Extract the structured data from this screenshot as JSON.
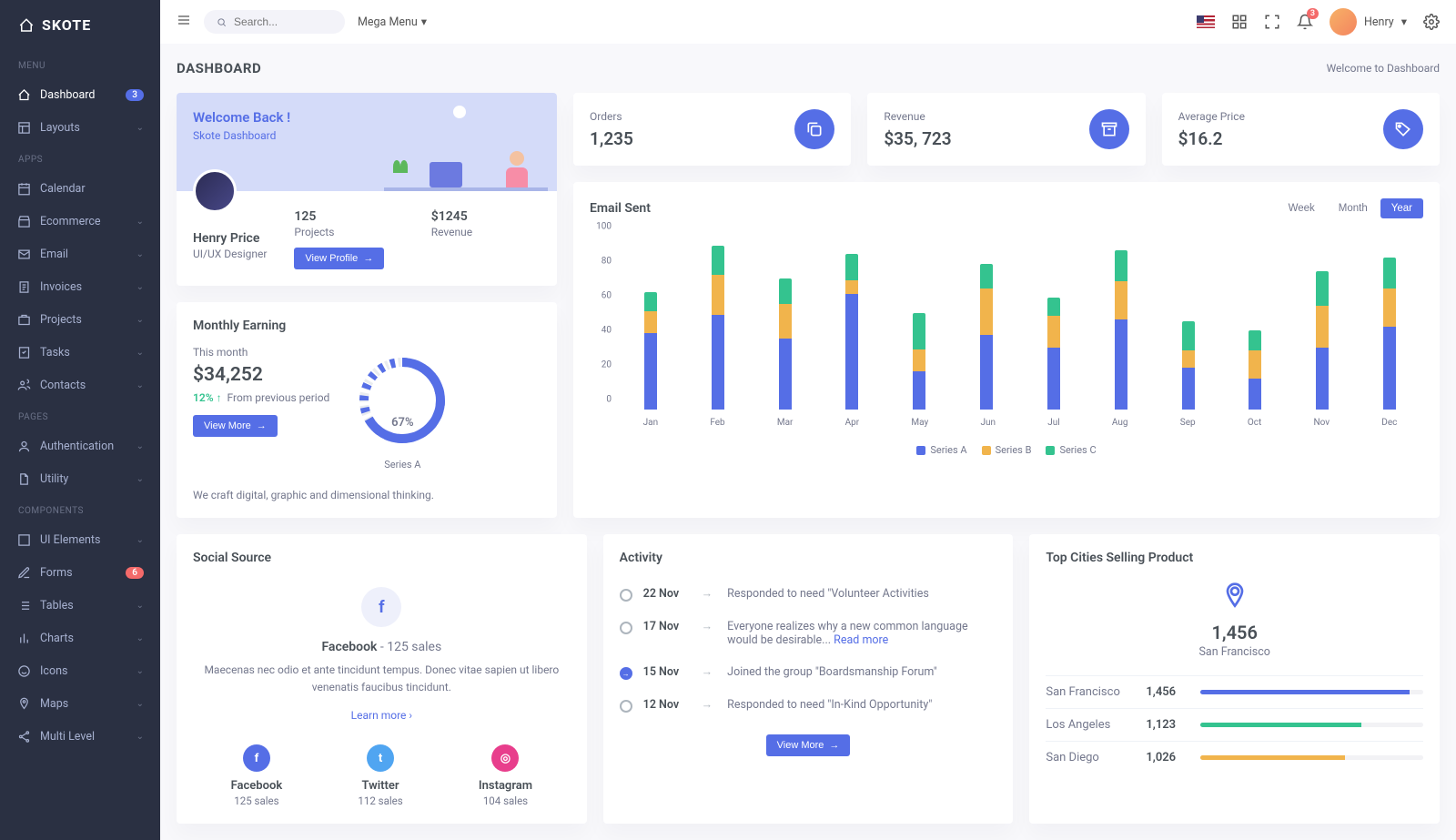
{
  "brand": "SKOTE",
  "header": {
    "search_placeholder": "Search...",
    "mega_menu": "Mega Menu",
    "username": "Henry",
    "notif_count": "3"
  },
  "sidebar": {
    "sections": [
      {
        "title": "MENU",
        "items": [
          {
            "label": "Dashboard",
            "icon": "home",
            "badge": "3",
            "badge_type": "primary",
            "active": true
          },
          {
            "label": "Layouts",
            "icon": "layout",
            "chevron": true
          }
        ]
      },
      {
        "title": "APPS",
        "items": [
          {
            "label": "Calendar",
            "icon": "calendar"
          },
          {
            "label": "Ecommerce",
            "icon": "store",
            "chevron": true
          },
          {
            "label": "Email",
            "icon": "mail",
            "chevron": true
          },
          {
            "label": "Invoices",
            "icon": "invoice",
            "chevron": true
          },
          {
            "label": "Projects",
            "icon": "briefcase",
            "chevron": true
          },
          {
            "label": "Tasks",
            "icon": "task",
            "chevron": true
          },
          {
            "label": "Contacts",
            "icon": "users",
            "chevron": true
          }
        ]
      },
      {
        "title": "PAGES",
        "items": [
          {
            "label": "Authentication",
            "icon": "user",
            "chevron": true
          },
          {
            "label": "Utility",
            "icon": "file",
            "chevron": true
          }
        ]
      },
      {
        "title": "COMPONENTS",
        "items": [
          {
            "label": "UI Elements",
            "icon": "box",
            "chevron": true
          },
          {
            "label": "Forms",
            "icon": "edit",
            "chevron": true,
            "badge": "6",
            "badge_type": "danger"
          },
          {
            "label": "Tables",
            "icon": "list",
            "chevron": true
          },
          {
            "label": "Charts",
            "icon": "bar",
            "chevron": true
          },
          {
            "label": "Icons",
            "icon": "smile",
            "chevron": true
          },
          {
            "label": "Maps",
            "icon": "pin",
            "chevron": true
          },
          {
            "label": "Multi Level",
            "icon": "share",
            "chevron": true
          }
        ]
      }
    ]
  },
  "page": {
    "title": "DASHBOARD",
    "breadcrumb": "Welcome to Dashboard"
  },
  "welcome": {
    "heading": "Welcome Back !",
    "subheading": "Skote Dashboard",
    "name": "Henry Price",
    "role": "UI/UX Designer",
    "projects_val": "125",
    "projects_label": "Projects",
    "revenue_val": "$1245",
    "revenue_label": "Revenue",
    "view_profile": "View Profile"
  },
  "stats": [
    {
      "label": "Orders",
      "value": "1,235",
      "icon": "copy"
    },
    {
      "label": "Revenue",
      "value": "$35, 723",
      "icon": "archive"
    },
    {
      "label": "Average Price",
      "value": "$16.2",
      "icon": "tag"
    }
  ],
  "earning": {
    "title": "Monthly Earning",
    "period": "This month",
    "amount": "$34,252",
    "pct": "12%",
    "pct_note": "From previous period",
    "view_more": "View More",
    "desc": "We craft digital, graphic and dimensional thinking.",
    "radial_pct": "67%",
    "radial_series": "Series A"
  },
  "email_chart": {
    "title": "Email Sent",
    "toggle": [
      "Week",
      "Month",
      "Year"
    ],
    "active_toggle": "Year",
    "legend": [
      "Series A",
      "Series B",
      "Series C"
    ]
  },
  "chart_data": {
    "type": "bar",
    "stacked": true,
    "categories": [
      "Jan",
      "Feb",
      "Mar",
      "Apr",
      "May",
      "Jun",
      "Jul",
      "Aug",
      "Sep",
      "Oct",
      "Nov",
      "Dec"
    ],
    "series": [
      {
        "name": "Series A",
        "color": "#556ee6",
        "values": [
          44,
          55,
          41,
          67,
          22,
          43,
          36,
          52,
          24,
          18,
          36,
          48
        ]
      },
      {
        "name": "Series B",
        "color": "#f1b44c",
        "values": [
          13,
          23,
          20,
          8,
          13,
          27,
          18,
          22,
          10,
          16,
          24,
          22
        ]
      },
      {
        "name": "Series C",
        "color": "#34c38f",
        "values": [
          11,
          17,
          15,
          15,
          21,
          14,
          11,
          18,
          17,
          12,
          20,
          18
        ]
      }
    ],
    "ylabel": "",
    "xlabel": "",
    "ylim": [
      0,
      100
    ],
    "yticks": [
      0,
      20,
      40,
      60,
      80,
      100
    ]
  },
  "social": {
    "title": "Social Source",
    "main_name": "Facebook",
    "main_sales": "125 sales",
    "desc": "Maecenas nec odio et ante tincidunt tempus. Donec vitae sapien ut libero venenatis faucibus tincidunt.",
    "learn_more": "Learn more",
    "items": [
      {
        "name": "Facebook",
        "sales": "125 sales",
        "cls": "si-fb",
        "glyph": "f"
      },
      {
        "name": "Twitter",
        "sales": "112 sales",
        "cls": "si-tw",
        "glyph": "t"
      },
      {
        "name": "Instagram",
        "sales": "104 sales",
        "cls": "si-ig",
        "glyph": "◎"
      }
    ]
  },
  "activity": {
    "title": "Activity",
    "view_more": "View More",
    "items": [
      {
        "date": "22 Nov",
        "text": "Responded to need \"Volunteer Activities",
        "active": false
      },
      {
        "date": "17 Nov",
        "text": "Everyone realizes why a new common language would be desirable... ",
        "link": "Read more",
        "active": false
      },
      {
        "date": "15 Nov",
        "text": "Joined the group \"Boardsmanship Forum\"",
        "active": true
      },
      {
        "date": "12 Nov",
        "text": "Responded to need \"In-Kind Opportunity\"",
        "active": false
      }
    ]
  },
  "cities": {
    "title": "Top Cities Selling Product",
    "top_val": "1,456",
    "top_name": "San Francisco",
    "rows": [
      {
        "name": "San Francisco",
        "val": "1,456",
        "pct": 94,
        "cls": "cb-primary"
      },
      {
        "name": "Los Angeles",
        "val": "1,123",
        "pct": 72,
        "cls": "cb-success"
      },
      {
        "name": "San Diego",
        "val": "1,026",
        "pct": 65,
        "cls": "cb-warning"
      }
    ]
  }
}
